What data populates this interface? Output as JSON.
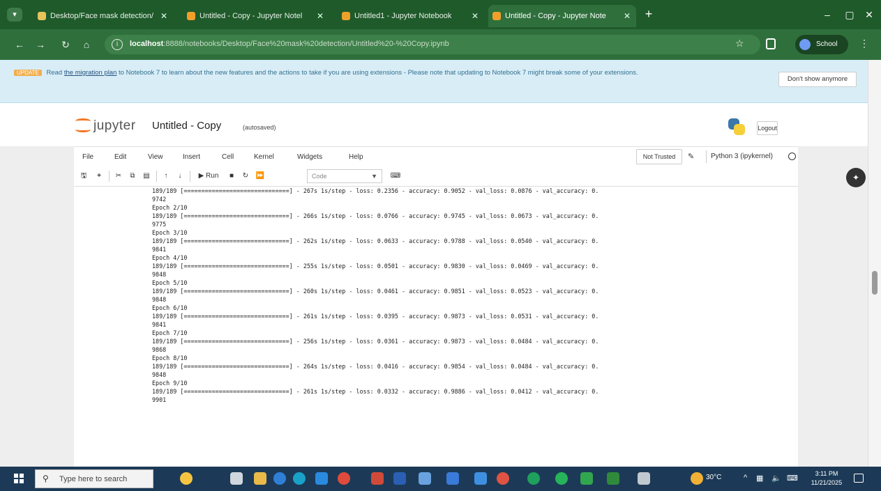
{
  "browser": {
    "tabs": [
      {
        "label": "Desktop/Face mask detection/",
        "active": false
      },
      {
        "label": "Untitled - Copy - Jupyter Notel",
        "active": false
      },
      {
        "label": "Untitled1 - Jupyter Notebook",
        "active": false
      },
      {
        "label": "Untitled - Copy - Jupyter Note",
        "active": true
      }
    ],
    "close_glyph": "✕",
    "new_tab_glyph": "+",
    "url_host": "localhost",
    "url_rest": ":8888/notebooks/Desktop/Face%20mask%20detection/Untitled%20-%20Copy.ipynb",
    "profile_label": "School"
  },
  "banner": {
    "badge": "UPDATE",
    "text_before": " Read ",
    "link": "the migration plan",
    "text_after": " to Notebook 7 to learn about the new features and the actions to take if you are using extensions - Please note that updating to Notebook 7 might break some of your extensions.",
    "dismiss": "Don't show anymore"
  },
  "header": {
    "brand": "jupyter",
    "title": "Untitled - Copy",
    "autosave": "(autosaved)",
    "logout": "Logout"
  },
  "menubar": {
    "items": [
      "File",
      "Edit",
      "View",
      "Insert",
      "Cell",
      "Kernel",
      "Widgets",
      "Help"
    ],
    "trust": "Not Trusted",
    "kernel": "Python 3 (ipykernel)"
  },
  "toolbar": {
    "run": "▶ Run",
    "celltype": "Code"
  },
  "output_lines": [
    "189/189 [==============================] - 267s 1s/step - loss: 0.2356 - accuracy: 0.9052 - val_loss: 0.0876 - val_accuracy: 0.",
    "9742",
    "Epoch 2/10",
    "189/189 [==============================] - 266s 1s/step - loss: 0.0766 - accuracy: 0.9745 - val_loss: 0.0673 - val_accuracy: 0.",
    "9775",
    "Epoch 3/10",
    "189/189 [==============================] - 262s 1s/step - loss: 0.0633 - accuracy: 0.9788 - val_loss: 0.0540 - val_accuracy: 0.",
    "9841",
    "Epoch 4/10",
    "189/189 [==============================] - 255s 1s/step - loss: 0.0501 - accuracy: 0.9830 - val_loss: 0.0469 - val_accuracy: 0.",
    "9848",
    "Epoch 5/10",
    "189/189 [==============================] - 260s 1s/step - loss: 0.0461 - accuracy: 0.9851 - val_loss: 0.0523 - val_accuracy: 0.",
    "9848",
    "Epoch 6/10",
    "189/189 [==============================] - 261s 1s/step - loss: 0.0395 - accuracy: 0.9873 - val_loss: 0.0531 - val_accuracy: 0.",
    "9841",
    "Epoch 7/10",
    "189/189 [==============================] - 256s 1s/step - loss: 0.0361 - accuracy: 0.9873 - val_loss: 0.0484 - val_accuracy: 0.",
    "9868",
    "Epoch 8/10",
    "189/189 [==============================] - 264s 1s/step - loss: 0.0416 - accuracy: 0.9854 - val_loss: 0.0484 - val_accuracy: 0.",
    "9848",
    "Epoch 9/10",
    "189/189 [==============================] - 261s 1s/step - loss: 0.0332 - accuracy: 0.9886 - val_loss: 0.0412 - val_accuracy: 0.",
    "9901"
  ],
  "taskbar": {
    "search_placeholder": "Type here to search",
    "weather": "30°C",
    "time": "3:11 PM",
    "date": "11/21/2025"
  },
  "colors": {
    "browser_frame": "#1f5a2a",
    "banner_bg": "#d9edf7",
    "jupyter_orange": "#f37726",
    "taskbar": "#1c3a57"
  },
  "scroll_position_fraction": 0.55
}
